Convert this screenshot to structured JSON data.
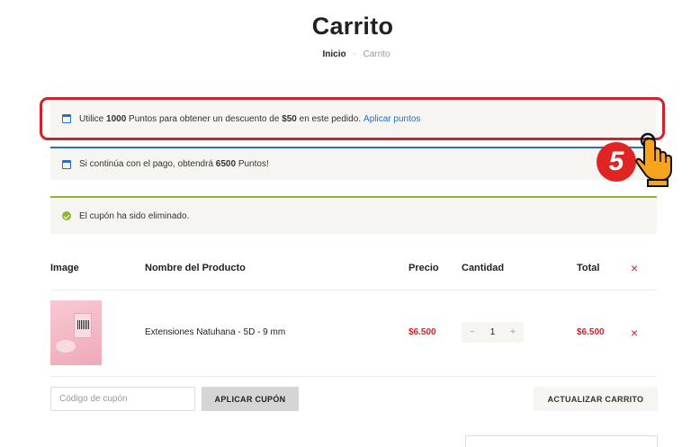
{
  "page": {
    "title": "Carrito"
  },
  "breadcrumb": {
    "home": "Inicio",
    "separator": "-",
    "current": "Carrito"
  },
  "notices": {
    "points_redeem": {
      "prefix": "Utilice",
      "points": "1000",
      "middle": "Puntos para obtener un descuento de",
      "discount": "$50",
      "suffix": "en este pedido.",
      "link": "Aplicar puntos",
      "icon": "calendar-icon"
    },
    "points_earn": {
      "prefix": "Si continúa con el pago, obtendrá",
      "points": "6500",
      "suffix": "Puntos!",
      "icon": "calendar-icon"
    },
    "coupon_removed": {
      "text": "El cupón ha sido eliminado.",
      "icon": "check-circle-icon"
    }
  },
  "tutorial": {
    "step": "5",
    "icon": "pointing-hand-icon"
  },
  "table": {
    "headers": {
      "image": "Image",
      "name": "Nombre del Producto",
      "price": "Precio",
      "quantity": "Cantidad",
      "total": "Total"
    },
    "remove_symbol": "×",
    "rows": [
      {
        "name": "Extensiones Natuhana - 5D - 9 mm",
        "price": "$6.500",
        "quantity": "1",
        "total": "$6.500"
      }
    ]
  },
  "quantity_controls": {
    "minus": "−",
    "plus": "+"
  },
  "coupon": {
    "placeholder": "Código de cupón",
    "apply_label": "APLICAR CUPÓN"
  },
  "update_cart_label": "ACTUALIZAR CARRITO",
  "colors": {
    "accent_blue": "#2a6fc2",
    "success_green": "#8fb431",
    "price_red": "#d71f26",
    "notice_bg": "#f6f5f1"
  }
}
